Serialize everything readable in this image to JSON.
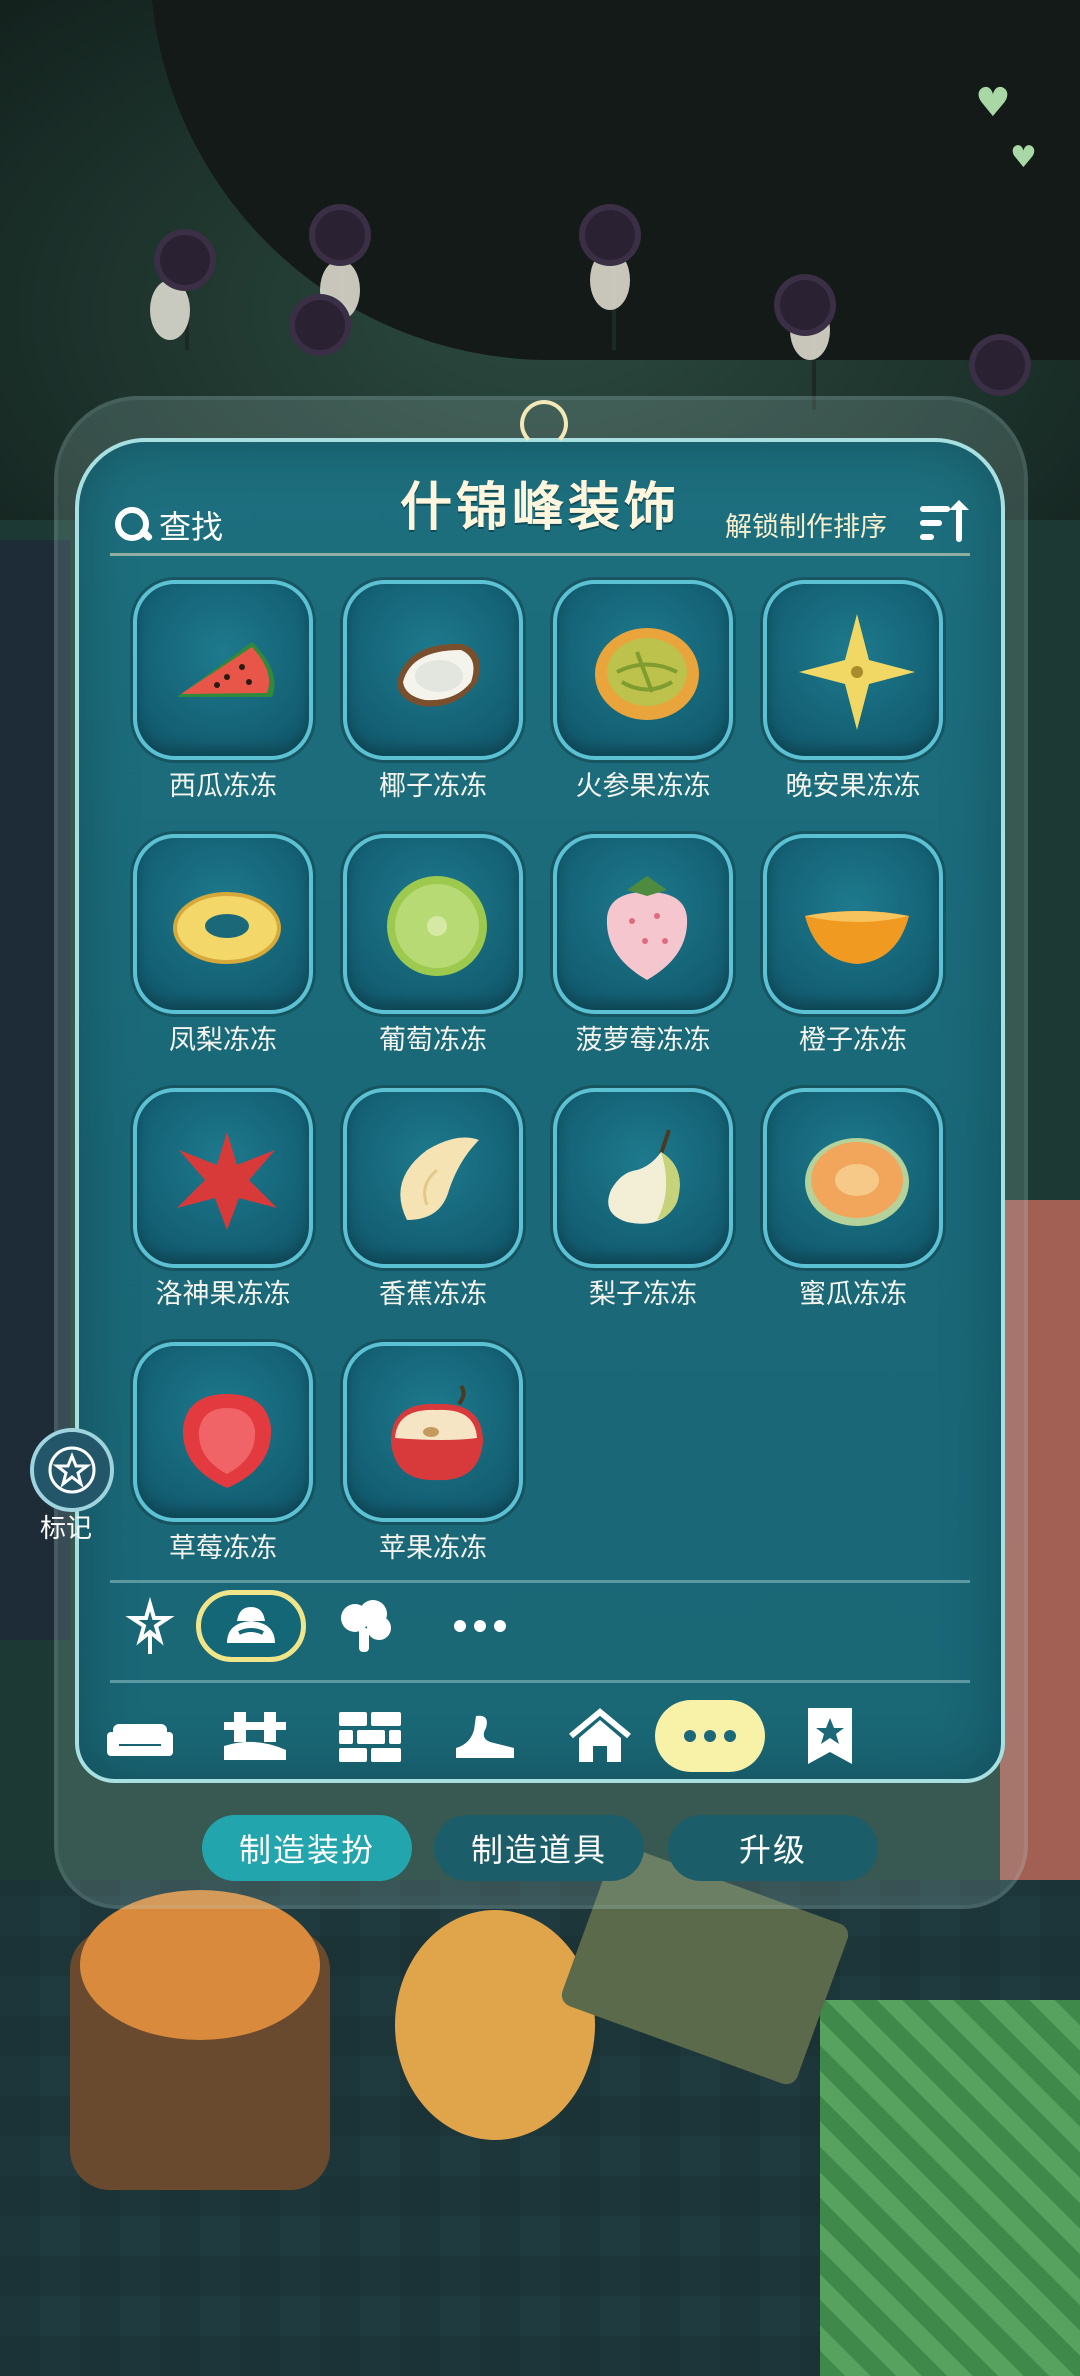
{
  "panel": {
    "title": "什锦峰装饰",
    "search_label": "查找",
    "sort_label": "解锁制作排序"
  },
  "items": [
    {
      "label": "西瓜冻冻",
      "icon": "watermelon-icon"
    },
    {
      "label": "椰子冻冻",
      "icon": "coconut-icon"
    },
    {
      "label": "火参果冻冻",
      "icon": "kiwano-icon"
    },
    {
      "label": "晚安果冻冻",
      "icon": "star-fruit-icon"
    },
    {
      "label": "凤梨冻冻",
      "icon": "pineapple-ring-icon"
    },
    {
      "label": "葡萄冻冻",
      "icon": "grape-slice-icon"
    },
    {
      "label": "菠萝莓冻冻",
      "icon": "pineberry-icon"
    },
    {
      "label": "橙子冻冻",
      "icon": "orange-slice-icon"
    },
    {
      "label": "洛神果冻冻",
      "icon": "roselle-icon"
    },
    {
      "label": "香蕉冻冻",
      "icon": "banana-icon"
    },
    {
      "label": "梨子冻冻",
      "icon": "pear-icon"
    },
    {
      "label": "蜜瓜冻冻",
      "icon": "melon-icon"
    },
    {
      "label": "草莓冻冻",
      "icon": "strawberry-icon"
    },
    {
      "label": "苹果冻冻",
      "icon": "apple-icon"
    }
  ],
  "subcategories": [
    {
      "icon": "sparkle-wand-icon",
      "selected": false
    },
    {
      "icon": "jelly-icon",
      "selected": true
    },
    {
      "icon": "mushroom-icon",
      "selected": false
    },
    {
      "icon": "more-icon",
      "selected": false
    }
  ],
  "categories": [
    {
      "icon": "sofa-icon",
      "selected": false
    },
    {
      "icon": "bench-icon",
      "selected": false
    },
    {
      "icon": "brick-wall-icon",
      "selected": false
    },
    {
      "icon": "shoe-icon",
      "selected": false
    },
    {
      "icon": "house-icon",
      "selected": false
    },
    {
      "icon": "more-icon",
      "selected": true
    },
    {
      "icon": "star-badge-icon",
      "selected": false
    }
  ],
  "tabs": [
    {
      "label": "制造装扮",
      "active": true
    },
    {
      "label": "制造道具",
      "active": false
    },
    {
      "label": "升级",
      "active": false
    }
  ],
  "marker": {
    "label": "标记",
    "icon": "star-circle-icon"
  },
  "colors": {
    "panel_bg": "#1a6878",
    "tile_border": "#5cc1d2",
    "active_tab": "#23a5ae",
    "selected_ring": "#f1e58a"
  }
}
